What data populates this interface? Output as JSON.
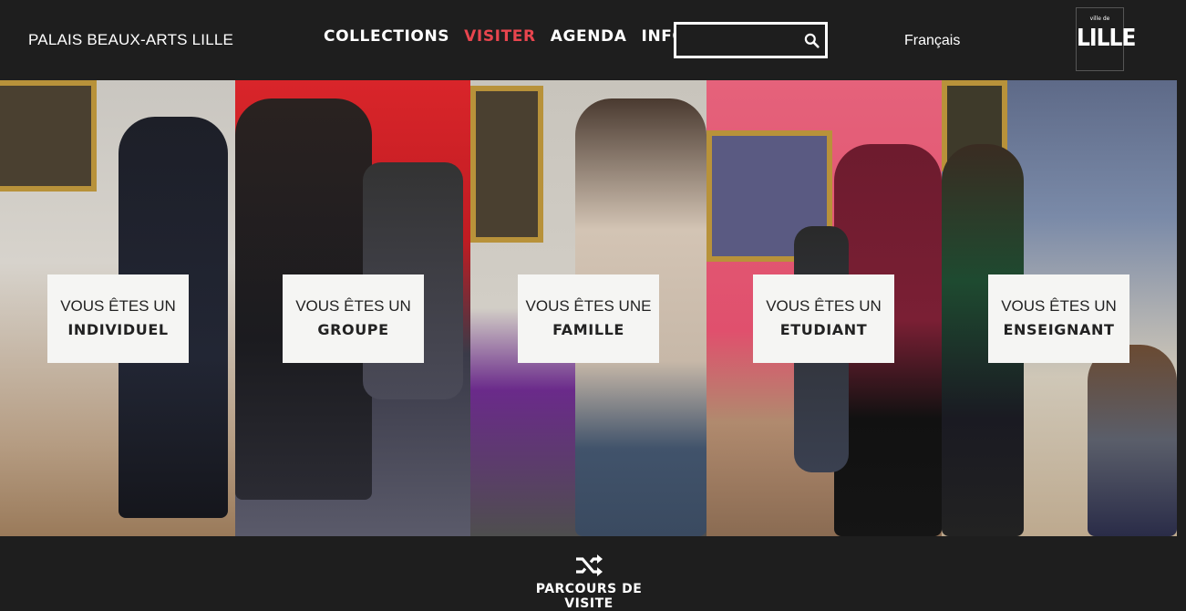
{
  "header": {
    "brand": "PALAIS BEAUX-ARTS LILLE",
    "nav": [
      {
        "label": "COLLECTIONS"
      },
      {
        "label": "VISITER"
      },
      {
        "label": "AGENDA"
      },
      {
        "label": "INFOS"
      }
    ],
    "search": {
      "value": "",
      "placeholder": ""
    },
    "language": "Français",
    "logo": {
      "small": "ville de",
      "big": "LILLE"
    }
  },
  "panels": [
    {
      "line1": "VOUS ÊTES UN",
      "line2": "INDIVIDUEL"
    },
    {
      "line1": "VOUS ÊTES UN",
      "line2": "GROUPE"
    },
    {
      "line1": "VOUS ÊTES UNE",
      "line2": "FAMILLE"
    },
    {
      "line1": "VOUS ÊTES UN",
      "line2": "ETUDIANT"
    },
    {
      "line1": "VOUS ÊTES UN",
      "line2": "ENSEIGNANT"
    }
  ],
  "footer": {
    "parcours_label": "PARCOURS DE VISITE"
  },
  "colors": {
    "accent": "#e8454e",
    "header_bg": "#1e1e1e",
    "card_bg": "#f5f5f3"
  }
}
